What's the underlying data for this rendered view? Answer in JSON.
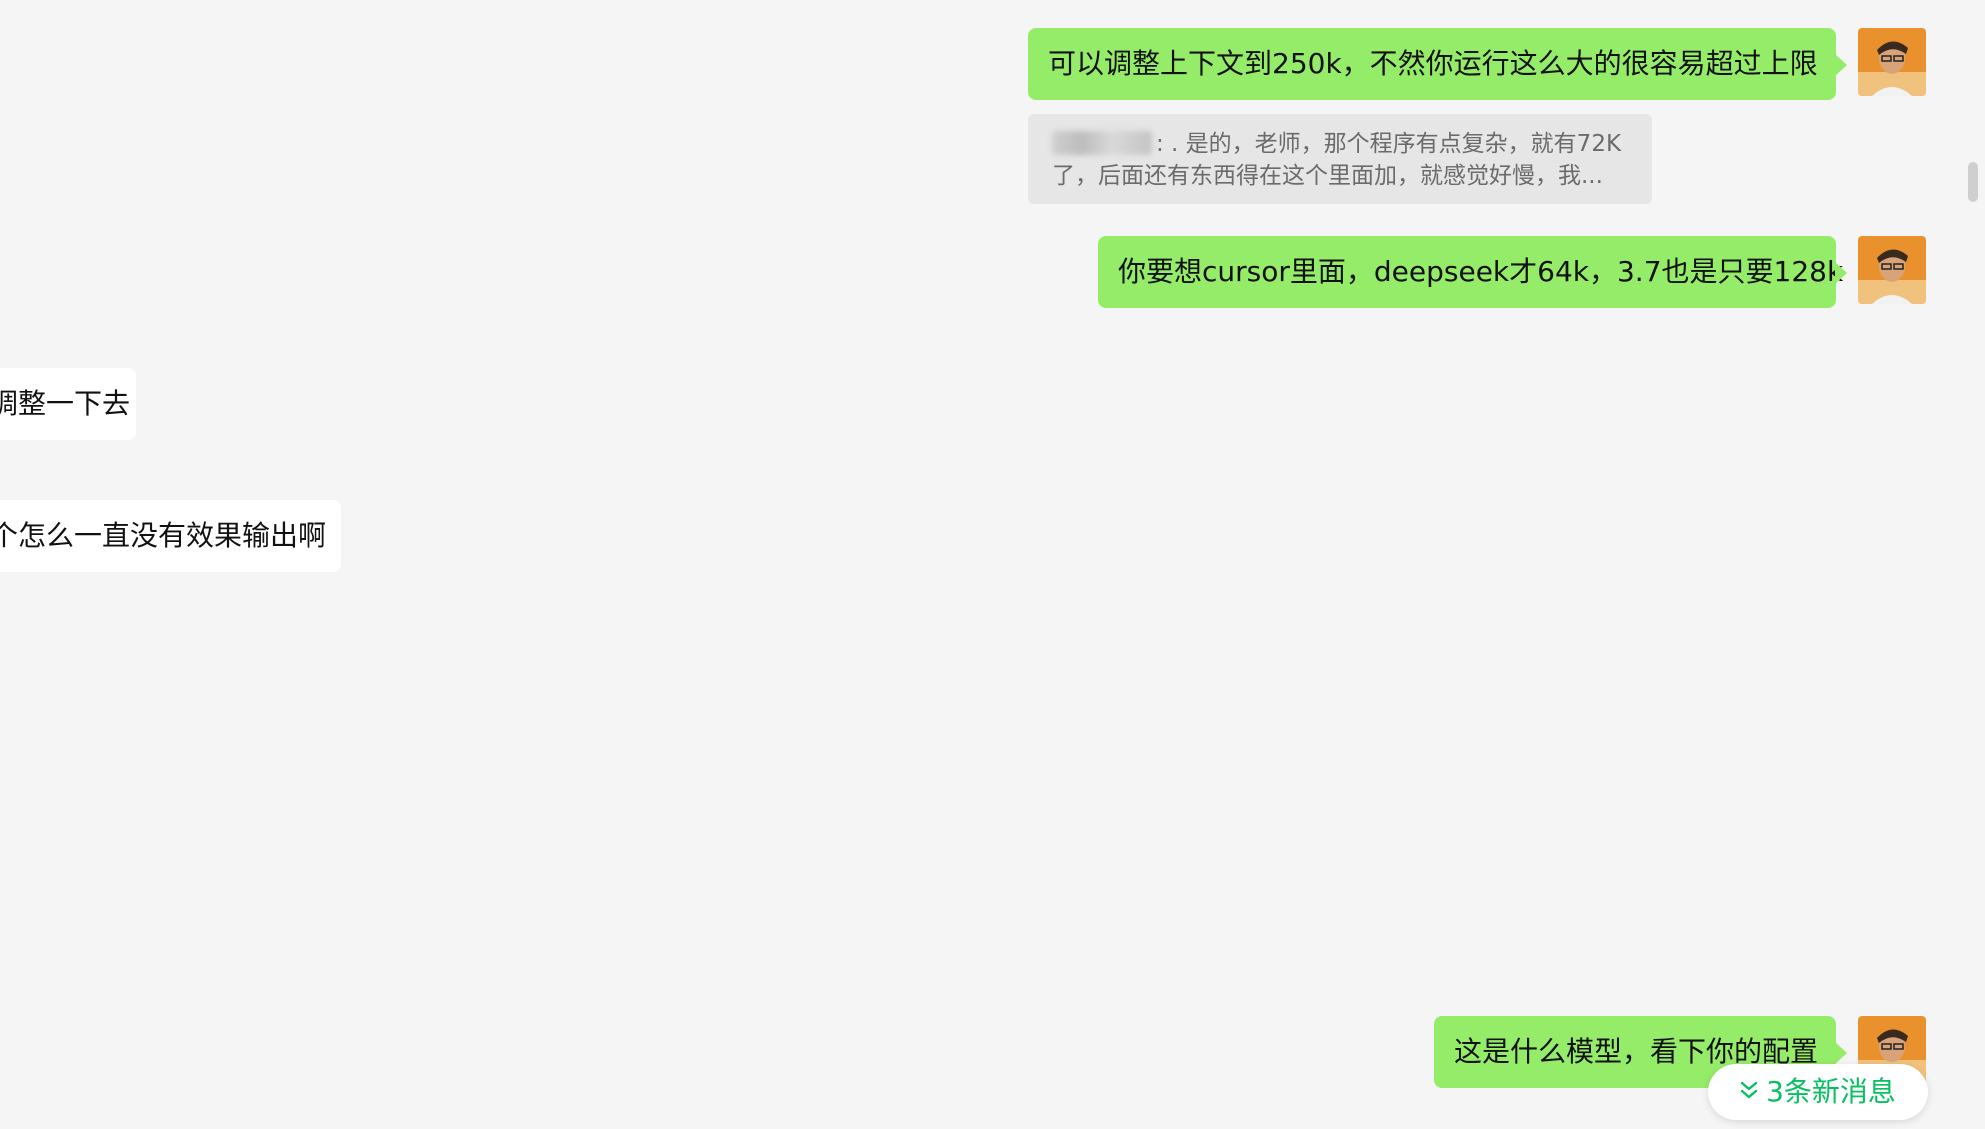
{
  "messages": [
    {
      "id": "m1",
      "direction": "out",
      "text": "可以调整上下文到250k，不然你运行这么大的很容易超过上限"
    },
    {
      "id": "m1_quote",
      "direction": "quote",
      "text": ": . 是的，老师，那个程序有点复杂，就有72K 了，后面还有东西得在这个里面加，就感觉好慢，我..."
    },
    {
      "id": "m2",
      "direction": "out",
      "text": "你要想cursor里面，deepseek才64k，3.7也是只要128k"
    },
    {
      "id": "m3",
      "direction": "in",
      "text": "调整一下去"
    },
    {
      "id": "m4",
      "direction": "in",
      "text": "个怎么一直没有效果输出啊"
    },
    {
      "id": "m5",
      "direction": "out",
      "text": "这是什么模型，看下你的配置"
    }
  ],
  "new_messages": {
    "icon": "double-chevron-down-icon",
    "label": "3条新消息"
  },
  "colors": {
    "outgoing": "#95ec69",
    "incoming": "#ffffff",
    "background": "#f5f5f5",
    "accent": "#07c160"
  }
}
